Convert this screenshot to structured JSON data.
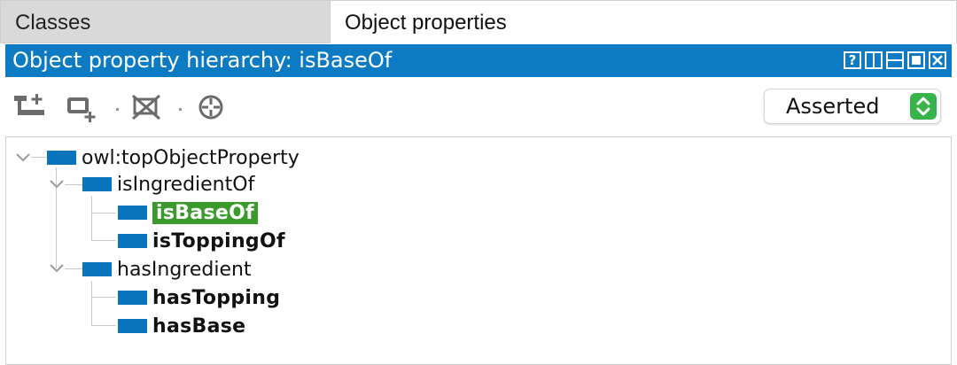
{
  "tabs": {
    "classes": "Classes",
    "object_properties": "Object properties"
  },
  "panel": {
    "title": "Object property hierarchy: isBaseOf",
    "help_glyph": "?"
  },
  "toolbar": {
    "mode_select": "Asserted"
  },
  "tree": {
    "root": "owl:topObjectProperty",
    "n1": "isIngredientOf",
    "n1a": "isBaseOf",
    "n1b": "isToppingOf",
    "n2": "hasIngredient",
    "n2a": "hasTopping",
    "n2b": "hasBase"
  },
  "colors": {
    "titlebar": "#0d7bc3",
    "property_icon": "#0a74bd",
    "selection": "#3a9a2c",
    "select_caret": "#38b54a"
  }
}
